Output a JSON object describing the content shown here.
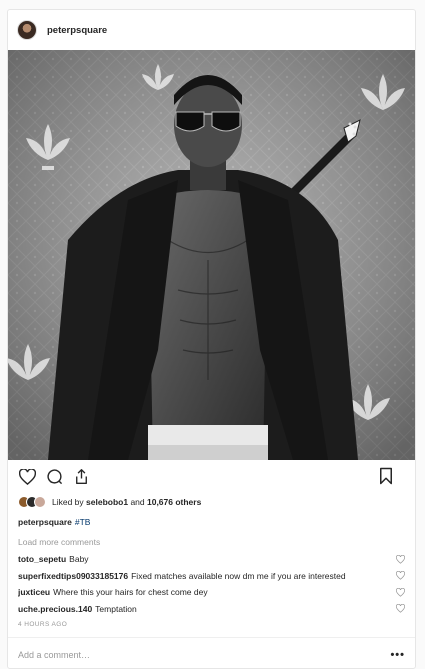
{
  "post": {
    "username": "peterpsquare",
    "photo_alt": "Photo by peterpsquare"
  },
  "actions": {
    "like_icon": "heart-icon",
    "comment_icon": "comment-icon",
    "share_icon": "share-icon",
    "save_icon": "bookmark-icon"
  },
  "likes": {
    "prefix": "Liked by ",
    "first_user": "selebobo1",
    "middle": " and ",
    "others": "10,676 others"
  },
  "caption": {
    "username": "peterpsquare",
    "text": "#TB"
  },
  "load_more": "Load more comments",
  "comments": [
    {
      "username": "toto_sepetu",
      "text": "Baby"
    },
    {
      "username": "superfixedtips09033185176",
      "text": "Fixed matches available now dm me if you are interested"
    },
    {
      "username": "juxticeu",
      "text": "Where this your hairs for chest come dey"
    },
    {
      "username": "uche.precious.140",
      "text": "Temptation"
    }
  ],
  "timestamp": "4 HOURS AGO",
  "add_comment": {
    "placeholder": "Add a comment…",
    "more_label": "•••"
  },
  "colors": {
    "link": "#003569",
    "muted": "#999999",
    "border": "#e6e6e6"
  }
}
